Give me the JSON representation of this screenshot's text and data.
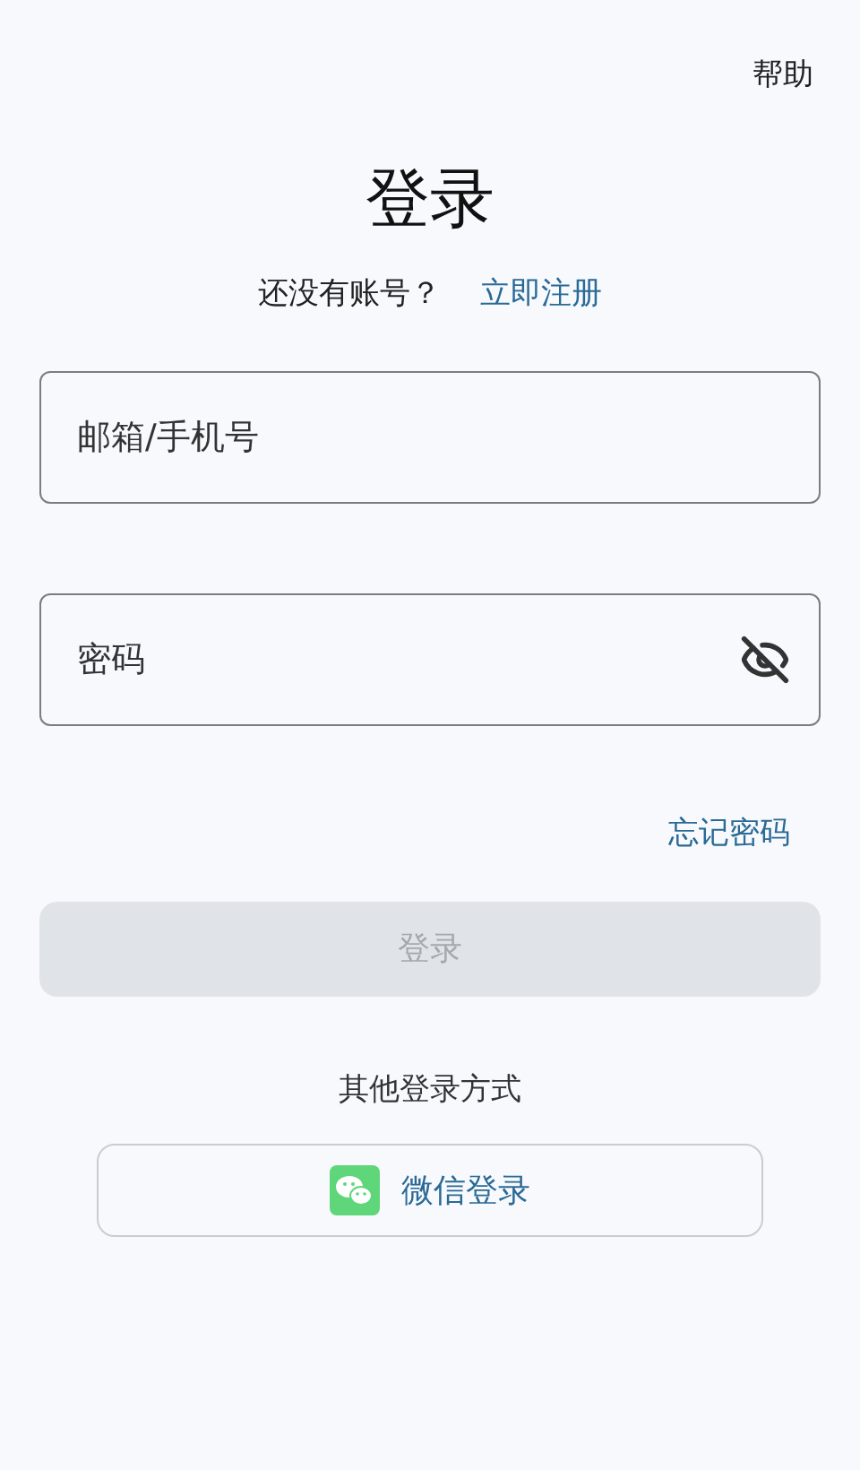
{
  "help_link": "帮助",
  "title": "登录",
  "signup_prompt": {
    "text": "还没有账号？",
    "link": "立即注册"
  },
  "account_field": {
    "placeholder": "邮箱/手机号"
  },
  "password_field": {
    "placeholder": "密码",
    "show_password": false
  },
  "forgot_password": "忘记密码",
  "login_button": {
    "label": "登录",
    "disabled": true
  },
  "other_methods": {
    "heading": "其他登录方式",
    "buttons": [
      {
        "kind": "wechat",
        "label": "微信登录"
      }
    ]
  }
}
